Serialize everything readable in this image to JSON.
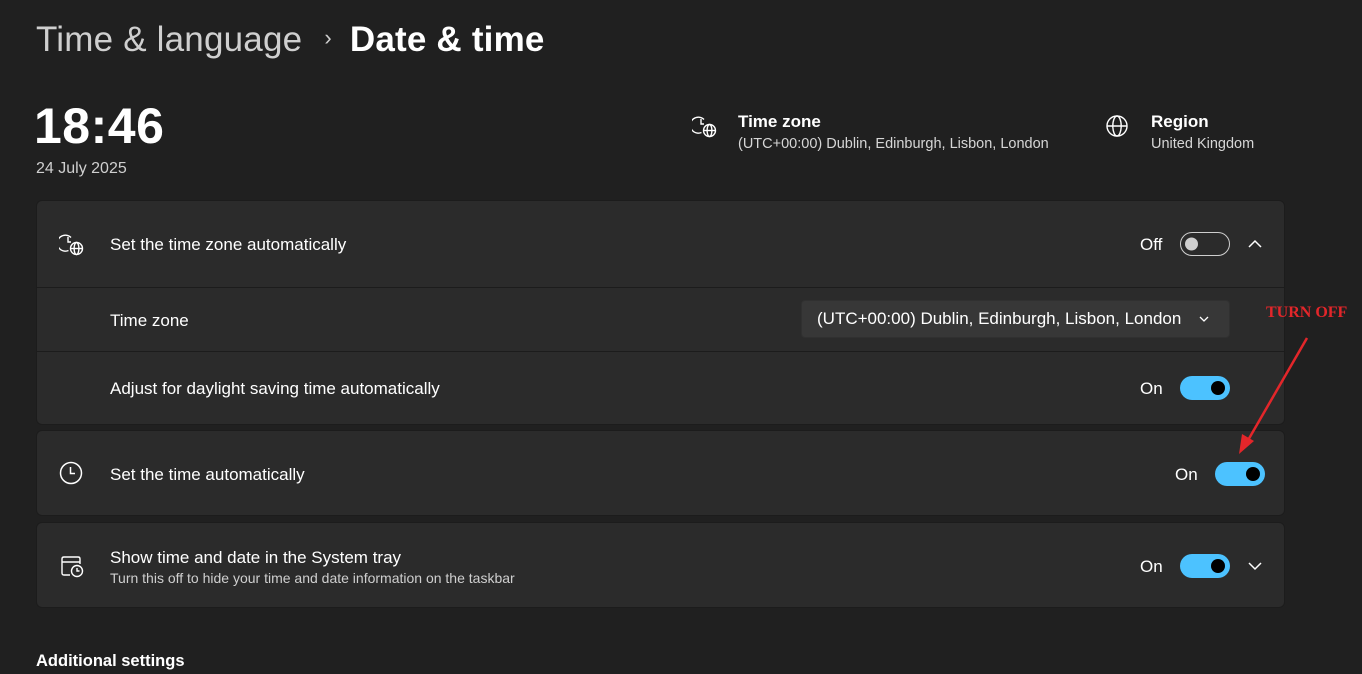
{
  "breadcrumb": {
    "parent": "Time & language",
    "separator": "›",
    "current": "Date & time"
  },
  "clock": {
    "time": "18:46",
    "date": "24 July 2025"
  },
  "summary": {
    "timezone": {
      "title": "Time zone",
      "value": "(UTC+00:00) Dublin, Edinburgh, Lisbon, London",
      "icon": "clock-globe-icon"
    },
    "region": {
      "title": "Region",
      "value": "United Kingdom",
      "icon": "globe-icon"
    }
  },
  "settings": {
    "auto_timezone": {
      "label": "Set the time zone automatically",
      "state": "Off",
      "toggle_on": false,
      "icon": "clock-globe-icon",
      "expanded": true
    },
    "timezone_select": {
      "label": "Time zone",
      "value": "(UTC+00:00) Dublin, Edinburgh, Lisbon, London"
    },
    "dst": {
      "label": "Adjust for daylight saving time automatically",
      "state": "On",
      "toggle_on": true
    },
    "auto_time": {
      "label": "Set the time automatically",
      "state": "On",
      "toggle_on": true,
      "icon": "clock-icon"
    },
    "systray": {
      "label": "Show time and date in the System tray",
      "description": "Turn this off to hide your time and date information on the taskbar",
      "state": "On",
      "toggle_on": true,
      "icon": "calendar-clock-icon",
      "expanded": false
    }
  },
  "annotation": {
    "text": "TURN OFF",
    "color": "#e3262a"
  },
  "additional": {
    "title": "Additional settings"
  },
  "colors": {
    "background": "#202020",
    "card": "#2b2b2b",
    "accent": "#4cc2ff"
  }
}
